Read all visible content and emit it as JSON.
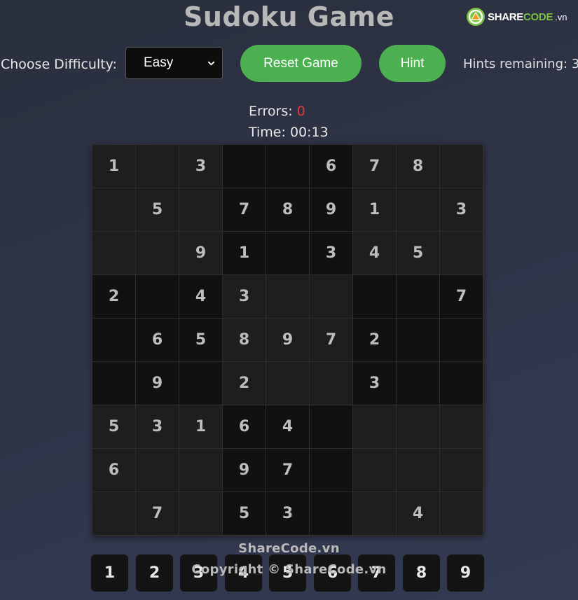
{
  "header": {
    "title": "Sudoku Game",
    "logo": {
      "brand_a": "SHARE",
      "brand_b": "CODE",
      "brand_c": ".vn",
      "icon": "sharecode-logo-icon"
    }
  },
  "controls": {
    "difficulty_label": "Choose Difficulty:",
    "difficulty_selected": "Easy",
    "reset_label": "Reset Game",
    "hint_label": "Hint",
    "hints_remaining_label": "Hints remaining:",
    "hints_remaining_value": "3"
  },
  "status": {
    "errors_label": "Errors:",
    "errors_value": "0",
    "time_label": "Time:",
    "time_value": "00:13"
  },
  "board": {
    "rows": [
      [
        "1",
        "",
        "3",
        "",
        "",
        "6",
        "7",
        "8",
        ""
      ],
      [
        "",
        "5",
        "",
        "7",
        "8",
        "9",
        "1",
        "",
        "3"
      ],
      [
        "",
        "",
        "9",
        "1",
        "",
        "3",
        "4",
        "5",
        ""
      ],
      [
        "2",
        "",
        "4",
        "3",
        "",
        "",
        "",
        "",
        "7"
      ],
      [
        "",
        "6",
        "5",
        "8",
        "9",
        "7",
        "2",
        "",
        ""
      ],
      [
        "",
        "9",
        "",
        "2",
        "",
        "",
        "3",
        "",
        ""
      ],
      [
        "5",
        "3",
        "1",
        "6",
        "4",
        "",
        "",
        "",
        ""
      ],
      [
        "6",
        "",
        "",
        "9",
        "7",
        "",
        "",
        "",
        ""
      ],
      [
        "",
        "7",
        "",
        "5",
        "3",
        "",
        "",
        "4",
        ""
      ]
    ]
  },
  "numpad": {
    "keys": [
      "1",
      "2",
      "3",
      "4",
      "5",
      "6",
      "7",
      "8",
      "9"
    ]
  },
  "footer": {
    "watermark": "ShareCode.vn",
    "copyright": "Copyright © ShareCode.vn"
  },
  "colors": {
    "accent": "#4caf50",
    "error": "#e53935",
    "brand_green": "#7ac143",
    "brand_orange": "#f7941d"
  }
}
